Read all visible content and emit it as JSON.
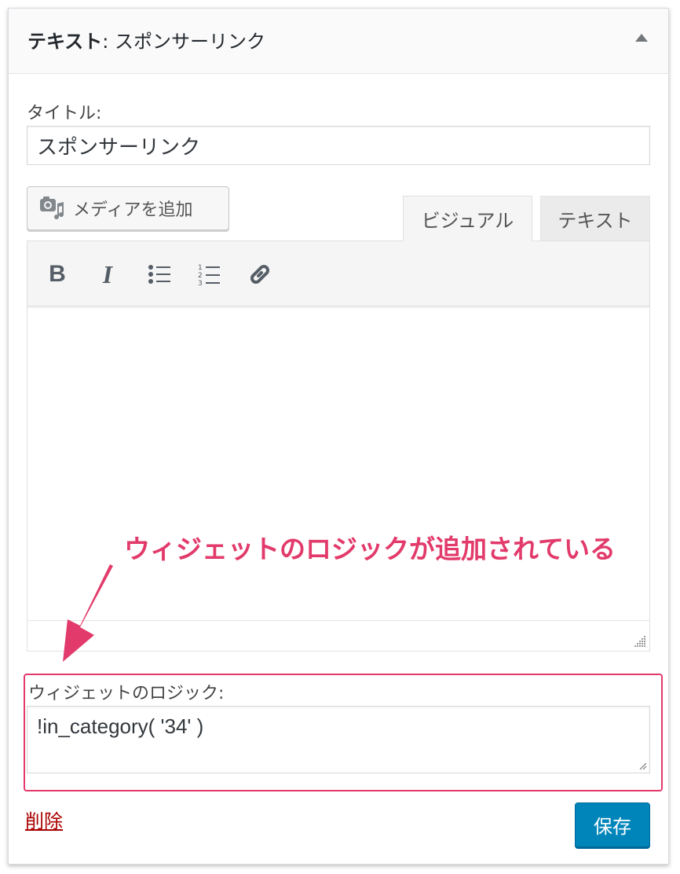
{
  "widget": {
    "title_main": "テキスト",
    "title_sep": ": ",
    "title_sub": "スポンサーリンク"
  },
  "title_field": {
    "label": "タイトル:",
    "value": "スポンサーリンク"
  },
  "media_button": {
    "label": "メディアを追加",
    "icon": "media-add-icon"
  },
  "editor_tabs": {
    "visual": "ビジュアル",
    "text": "テキスト",
    "active": "visual"
  },
  "toolbar": {
    "bold": "B",
    "italic": "I",
    "icons": [
      "bold-icon",
      "italic-icon",
      "bullet-list-icon",
      "numbered-list-icon",
      "link-icon"
    ]
  },
  "annotation": {
    "text": "ウィジェットのロジックが追加されている",
    "color": "#e23a6a"
  },
  "logic_field": {
    "label": "ウィジェットのロジック:",
    "value": "!in_category( '34' )"
  },
  "actions": {
    "delete": "削除",
    "save": "保存"
  },
  "colors": {
    "accent": "#e23a6a",
    "primary_button": "#0085ba",
    "delete_link": "#aa0000"
  }
}
